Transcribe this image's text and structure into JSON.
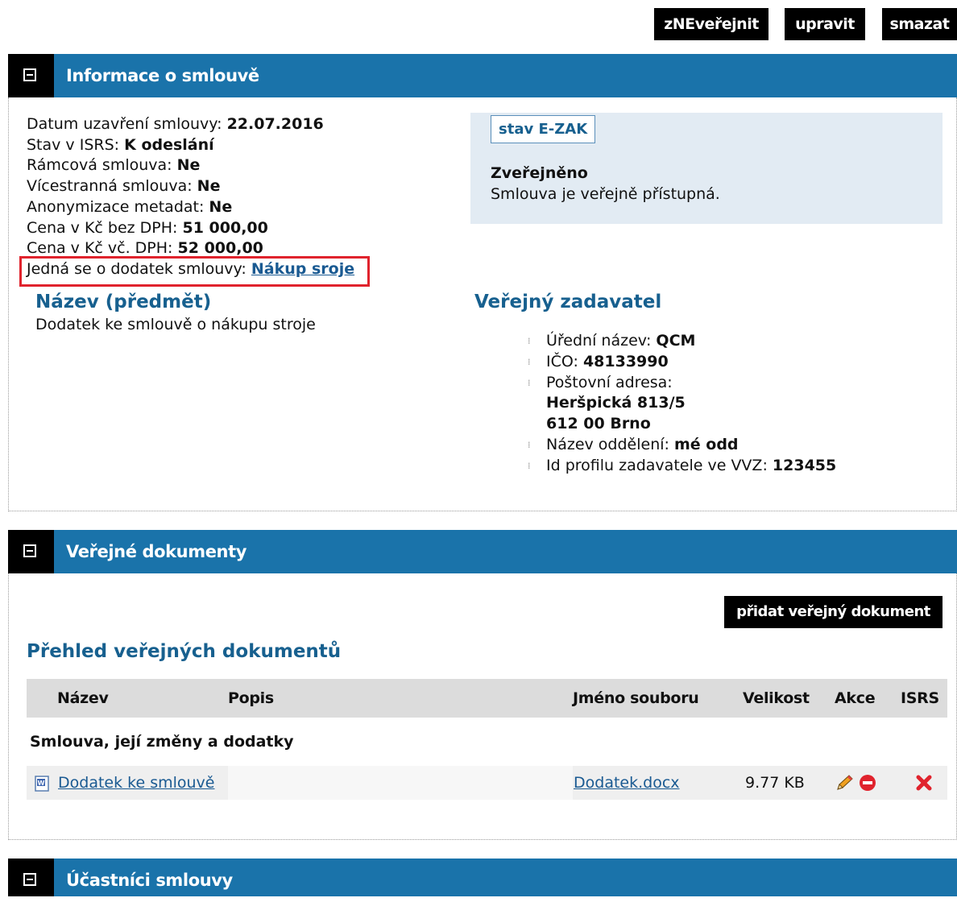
{
  "toolbar": {
    "unpublish_label": "zNEveřejnit",
    "edit_label": "upravit",
    "delete_label": "smazat"
  },
  "contract_info": {
    "section_title": "Informace o smlouvě",
    "date_label": "Datum uzavření smlouvy:",
    "date_value": "22.07.2016",
    "isrs_state_label": "Stav v ISRS:",
    "isrs_state_value": "K odeslání",
    "framework_label": "Rámcová smlouva:",
    "framework_value": "Ne",
    "multilateral_label": "Vícestranná smlouva:",
    "multilateral_value": "Ne",
    "anonymization_label": "Anonymizace metadat:",
    "anonymization_value": "Ne",
    "price_excl_label": "Cena v Kč bez DPH:",
    "price_excl_value": "51 000,00",
    "price_incl_label": "Cena v Kč vč. DPH:",
    "price_incl_value": "52 000,00",
    "addendum_label": "Jedná se o dodatek smlouvy:",
    "addendum_link": "Nákup sroje",
    "name_heading": "Název (předmět)",
    "name_value": "Dodatek ke smlouvě o nákupu stroje"
  },
  "status_panel": {
    "button_label": "stav E-ZAK",
    "status_title": "Zveřejněno",
    "status_text": "Smlouva je veřejně přístupná."
  },
  "contracting_authority": {
    "heading": "Veřejný zadavatel",
    "official_name_label": "Úřední název:",
    "official_name_value": "QCM",
    "ico_label": "IČO:",
    "ico_value": "48133990",
    "address_label": "Poštovní adresa:",
    "address_line1": "Heršpická 813/5",
    "address_line2": "612 00 Brno",
    "department_label": "Název oddělení:",
    "department_value": "mé odd",
    "profile_id_label": "Id profilu zadavatele ve VVZ:",
    "profile_id_value": "123455"
  },
  "public_documents": {
    "section_title": "Veřejné dokumenty",
    "add_button_label": "přidat veřejný dokument",
    "overview_heading": "Přehled veřejných dokumentů",
    "columns": [
      "Název",
      "Popis",
      "Jméno souboru",
      "Velikost",
      "Akce",
      "ISRS"
    ],
    "group_label": "Smlouva, její změny a dodatky",
    "rows": [
      {
        "name": "Dodatek ke smlouvě",
        "description": "",
        "file_name": "Dodatek.docx",
        "size": "9.77 KB"
      }
    ]
  },
  "participants": {
    "section_title": "Účastníci smlouvy"
  },
  "colors": {
    "header_blue": "#1a73aa",
    "heading_blue": "#17608f",
    "highlight_red": "#e0232d",
    "panel_bg": "#e2ebf3"
  },
  "icons": {
    "collapse": "collapse-icon",
    "word_doc": "word-doc-icon",
    "edit": "pencil-icon",
    "remove": "remove-icon",
    "isrs": "red-x-icon"
  }
}
